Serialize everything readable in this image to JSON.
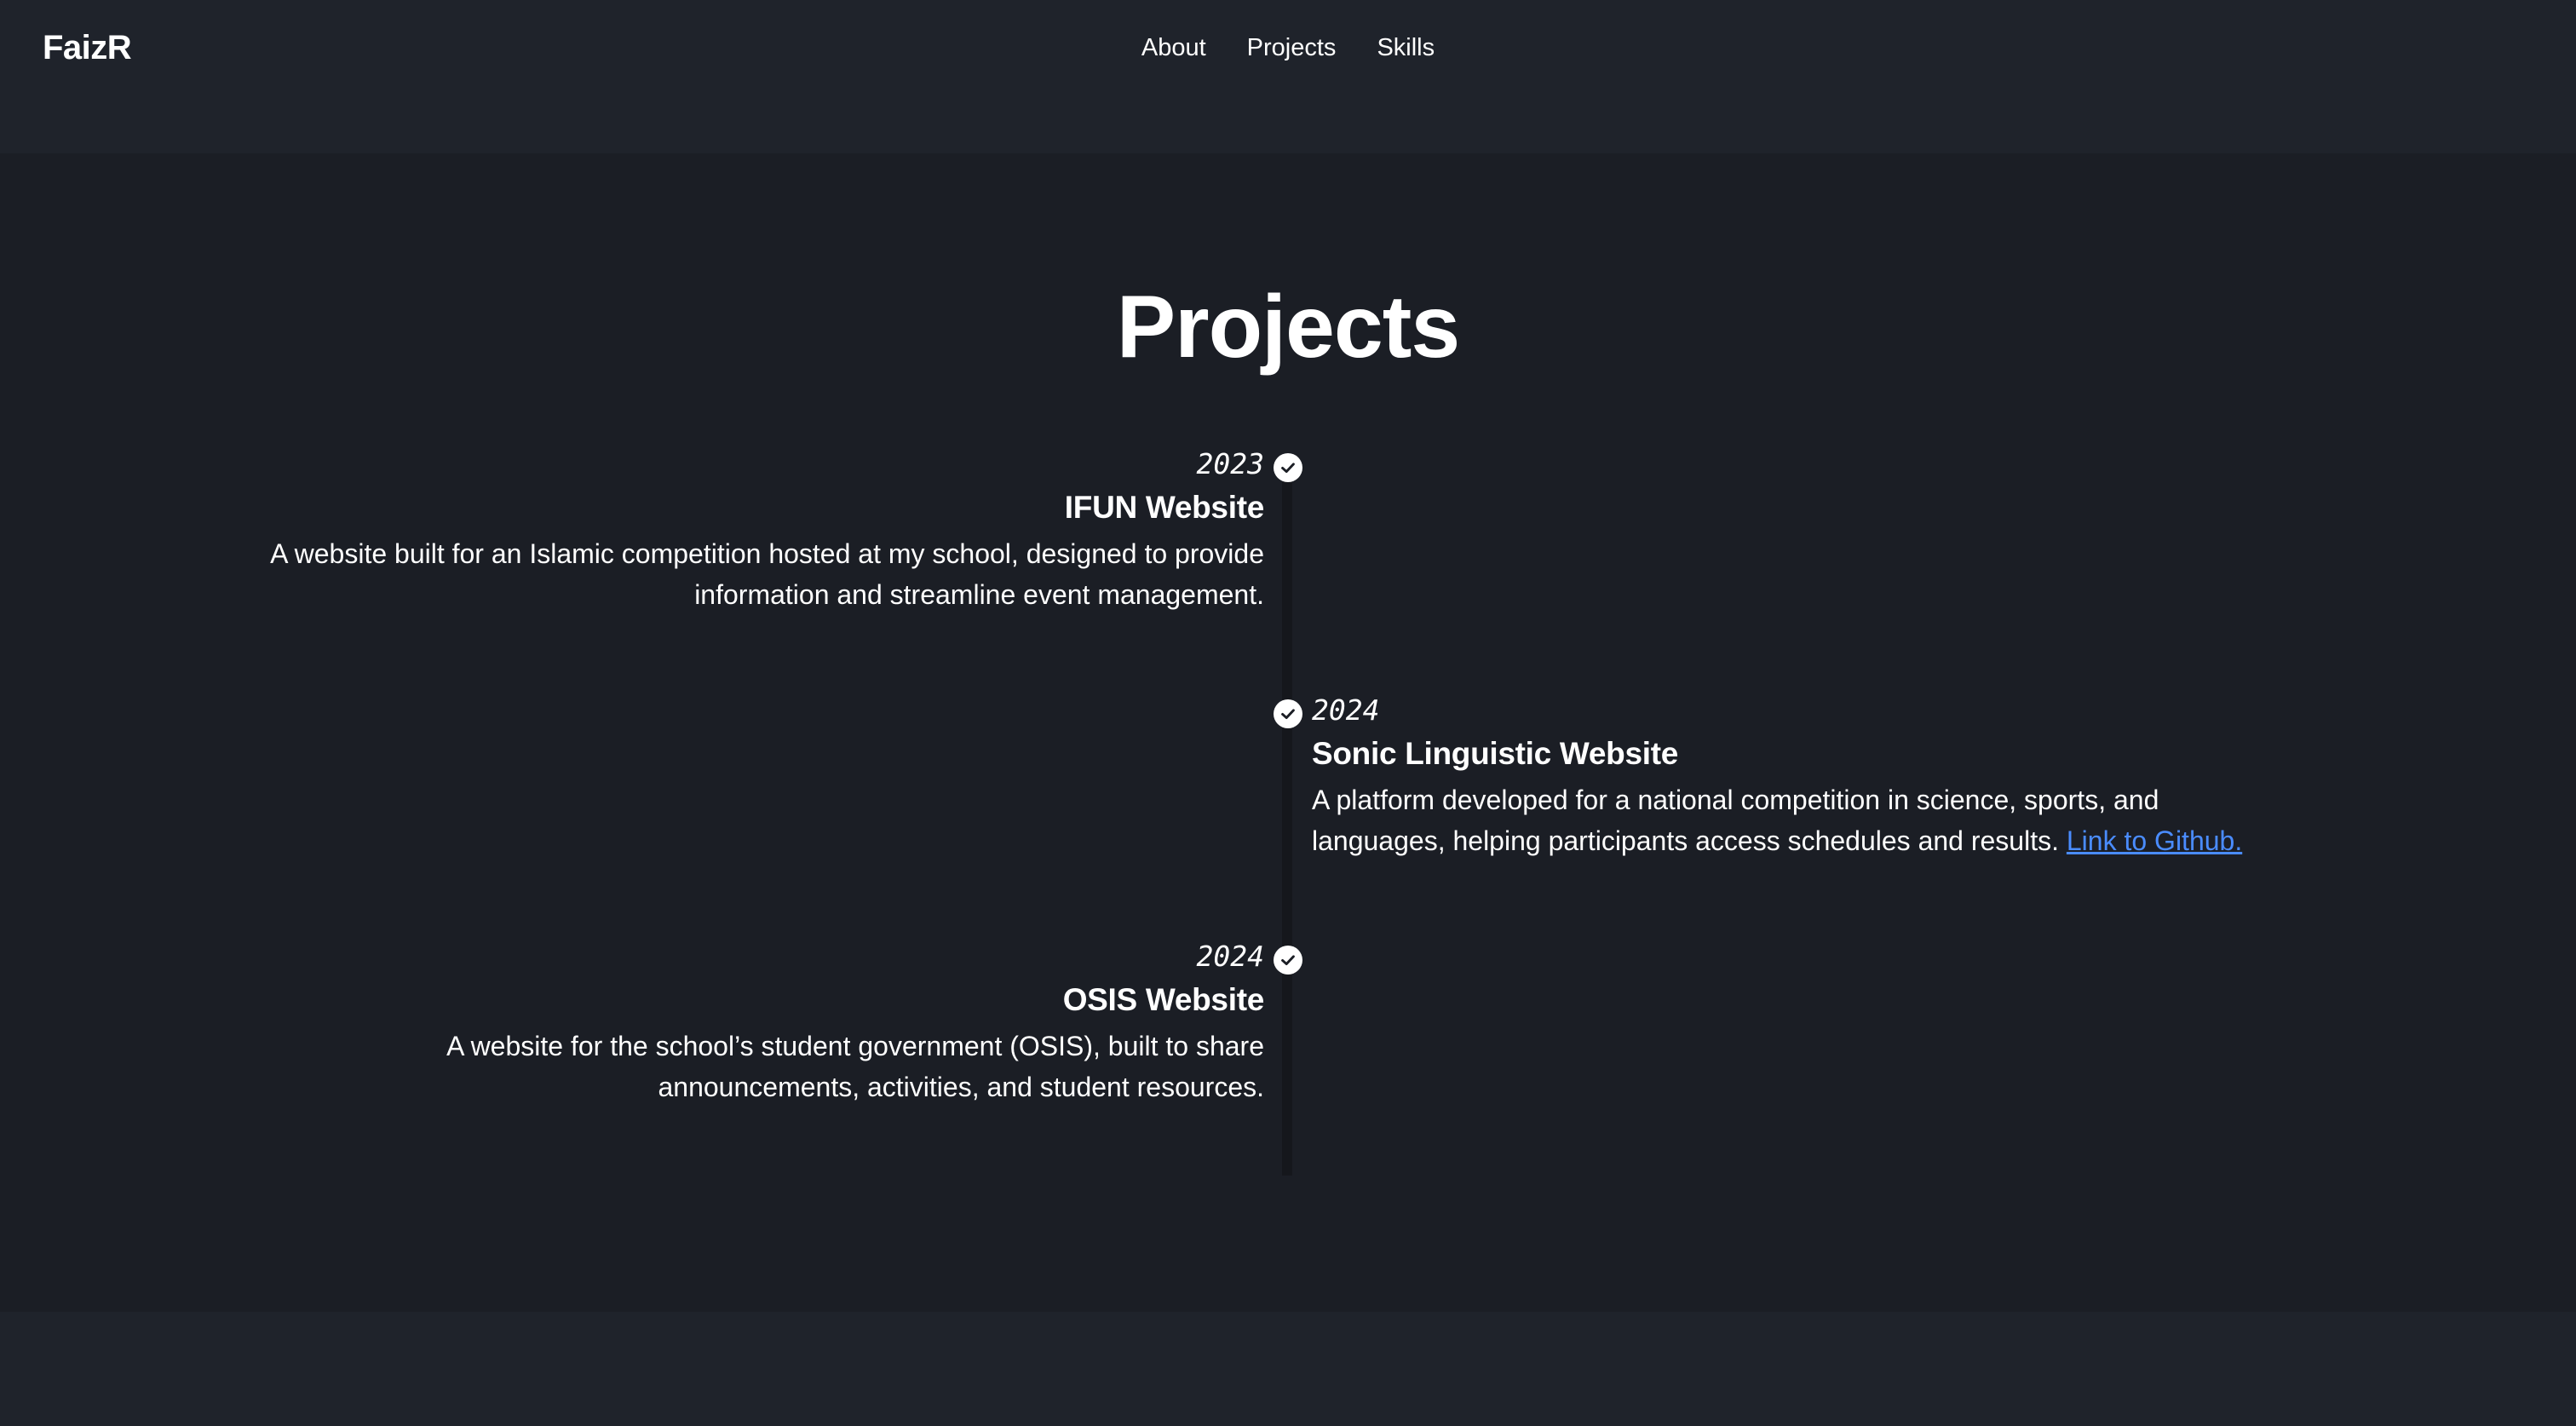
{
  "nav": {
    "brand": "FaizR",
    "links": [
      "About",
      "Projects",
      "Skills"
    ]
  },
  "projects": {
    "title": "Projects",
    "items": [
      {
        "year": "2023",
        "title": "IFUN Website",
        "description": "A website built for an Islamic competition hosted at my school, designed to provide information and streamline event management.",
        "link_text": ""
      },
      {
        "year": "2024",
        "title": "Sonic Linguistic Website",
        "description": "A platform developed for a national competition in science, sports, and languages, helping participants access schedules and results.",
        "link_text": "Link to Github."
      },
      {
        "year": "2024",
        "title": "OSIS Website",
        "description": "A website for the school’s student government (OSIS), built to share announcements, activities, and student resources.",
        "link_text": ""
      }
    ]
  },
  "colors": {
    "page_background": "#1b1e25",
    "navbar_background": "#1f232b",
    "link": "#4a8cff",
    "text": "#ffffff"
  },
  "icons": {
    "timeline_marker": "check-circle-icon"
  }
}
